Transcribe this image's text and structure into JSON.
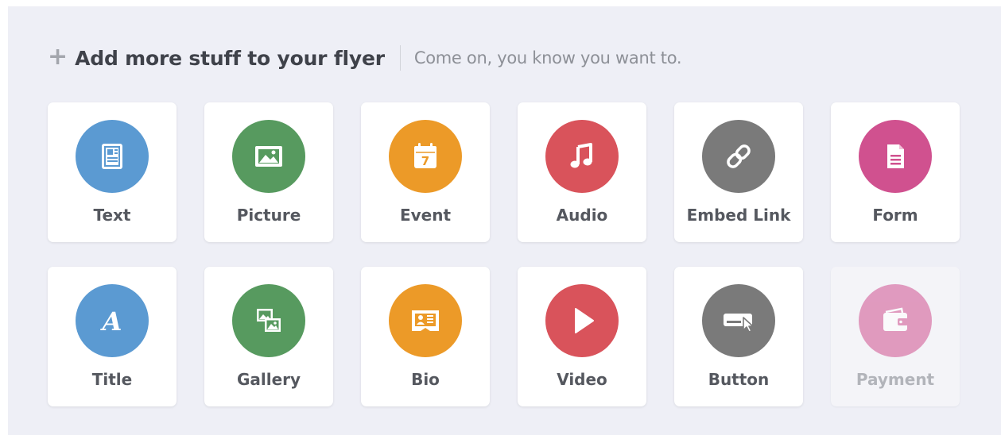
{
  "header": {
    "plus_symbol": "+",
    "title": "Add more stuff to your flyer",
    "subtitle": "Come on, you know you want to."
  },
  "tiles": [
    {
      "label": "Text",
      "icon": "text-document-icon",
      "color": "#5b9ad2",
      "enabled": true
    },
    {
      "label": "Picture",
      "icon": "picture-icon",
      "color": "#579a5f",
      "enabled": true
    },
    {
      "label": "Event",
      "icon": "calendar-icon",
      "color": "#ec9a28",
      "enabled": true,
      "calendar_day": "7"
    },
    {
      "label": "Audio",
      "icon": "music-note-icon",
      "color": "#d9535b",
      "enabled": true
    },
    {
      "label": "Embed Link",
      "icon": "link-icon",
      "color": "#7a7a7a",
      "enabled": true
    },
    {
      "label": "Form",
      "icon": "form-document-icon",
      "color": "#d0518f",
      "enabled": true
    },
    {
      "label": "Title",
      "icon": "title-letter-icon",
      "color": "#5b9ad2",
      "enabled": true,
      "glyph": "A"
    },
    {
      "label": "Gallery",
      "icon": "gallery-icon",
      "color": "#579a5f",
      "enabled": true
    },
    {
      "label": "Bio",
      "icon": "bio-card-icon",
      "color": "#ec9a28",
      "enabled": true
    },
    {
      "label": "Video",
      "icon": "play-icon",
      "color": "#d9535b",
      "enabled": true
    },
    {
      "label": "Button",
      "icon": "button-cursor-icon",
      "color": "#7a7a7a",
      "enabled": true
    },
    {
      "label": "Payment",
      "icon": "wallet-icon",
      "color": "#d0518f",
      "enabled": false
    }
  ]
}
